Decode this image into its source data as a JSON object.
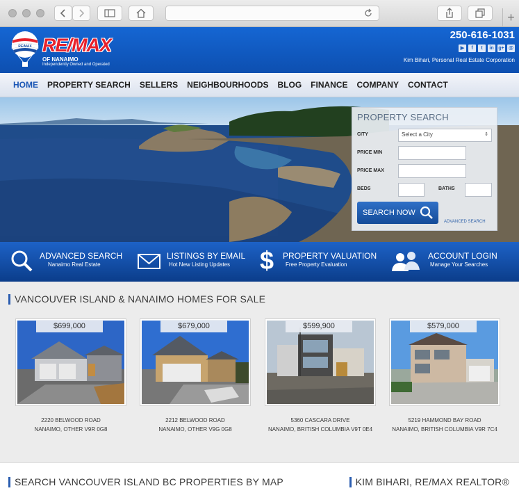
{
  "phone": "250-616-1031",
  "brand": {
    "wordmark": "RE/MAX",
    "office": "OF NANAIMO",
    "tagline": "Independently Owned and Operated"
  },
  "corporation": "Kim Bihari, Personal Real Estate Corporation",
  "social_icons": [
    "youtube-icon",
    "facebook-icon",
    "twitter-icon",
    "linkedin-icon",
    "google-plus-icon",
    "email-icon"
  ],
  "nav": [
    "HOME",
    "PROPERTY SEARCH",
    "SELLERS",
    "NEIGHBOURHOODS",
    "BLOG",
    "FINANCE",
    "COMPANY",
    "CONTACT"
  ],
  "search": {
    "title": "PROPERTY SEARCH",
    "city_label": "CITY",
    "city_value": "Select a City",
    "price_min_label": "PRICE MIN",
    "price_max_label": "PRICE MAX",
    "beds_label": "BEDS",
    "baths_label": "BATHS",
    "button": "SEARCH NOW",
    "advanced_link": "ADVANCED SEARCH"
  },
  "features": [
    {
      "title": "ADVANCED SEARCH",
      "sub": "Nanaimo Real Estate",
      "icon": "magnifier-icon"
    },
    {
      "title": "LISTINGS BY EMAIL",
      "sub": "Hot New Listing Updates",
      "icon": "envelope-icon"
    },
    {
      "title": "PROPERTY VALUATION",
      "sub": "Free Property Evaluation",
      "icon": "dollar-icon"
    },
    {
      "title": "ACCOUNT LOGIN",
      "sub": "Manage Your Searches",
      "icon": "users-icon"
    }
  ],
  "listings_title": "VANCOUVER ISLAND & NANAIMO HOMES FOR SALE",
  "listings": [
    {
      "price": "$699,000",
      "street": "2220 BELWOOD ROAD",
      "city": "NANAIMO, OTHER V9R 0G8"
    },
    {
      "price": "$679,000",
      "street": "2212 BELWOOD ROAD",
      "city": "NANAIMO, OTHER V9G 0G8"
    },
    {
      "price": "$599,900",
      "street": "5360 CASCARA DRIVE",
      "city": "NANAIMO, BRITISH COLUMBIA V9T 0E4"
    },
    {
      "price": "$579,000",
      "street": "5219 HAMMOND BAY ROAD",
      "city": "NANAIMO, BRITISH COLUMBIA V9R 7C4"
    }
  ],
  "map_title": "SEARCH VANCOUVER ISLAND BC PROPERTIES BY MAP",
  "realtor_title": "KIM BIHARI, RE/MAX REALTOR®",
  "colors": {
    "brand_blue": "#1566d3",
    "remax_red": "#e8222c",
    "nav_active": "#1a56b5"
  }
}
